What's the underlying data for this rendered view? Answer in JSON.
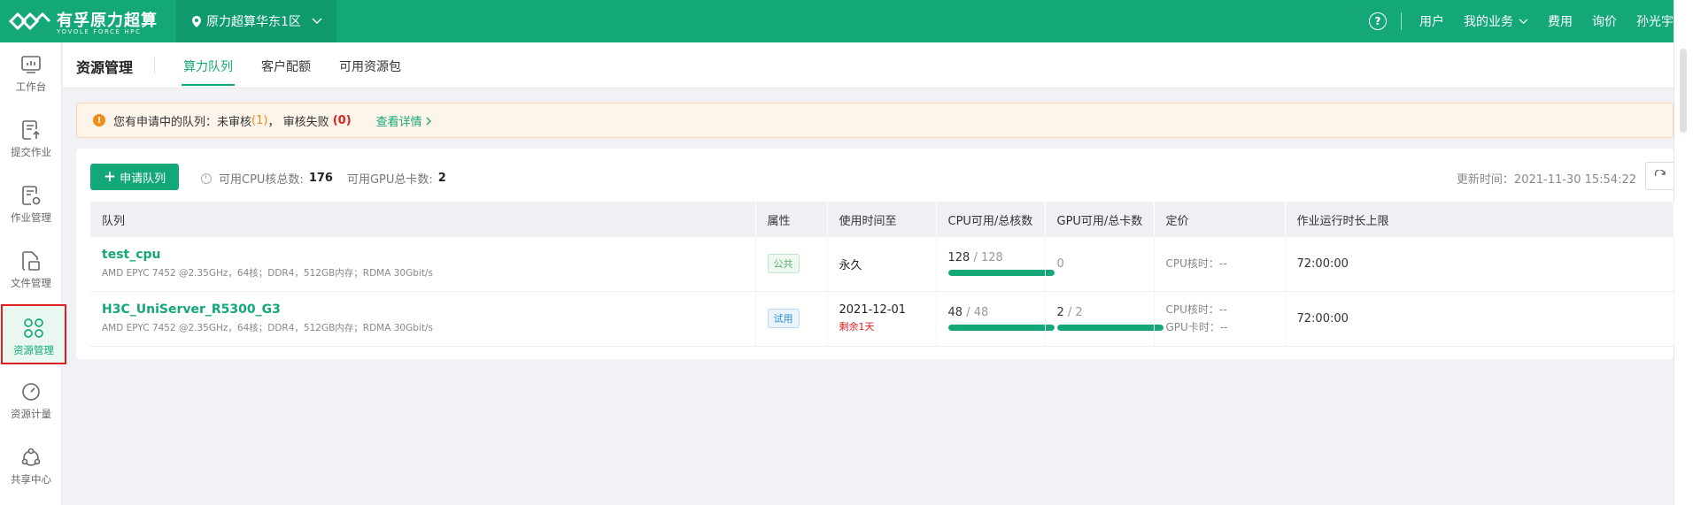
{
  "brand": {
    "name": "有孚原力超算",
    "sub": "YOVOLE FORCE HPC"
  },
  "region": {
    "label": "原力超算华东1区"
  },
  "top_nav": {
    "help": "?",
    "user": "用户",
    "business": "我的业务",
    "fee": "费用",
    "inquiry": "询价",
    "username": "孙光宇"
  },
  "sidebar": {
    "items": [
      {
        "label": "工作台",
        "icon": "dashboard-icon"
      },
      {
        "label": "提交作业",
        "icon": "submit-job-icon"
      },
      {
        "label": "作业管理",
        "icon": "job-manage-icon"
      },
      {
        "label": "文件管理",
        "icon": "file-manage-icon"
      },
      {
        "label": "资源管理",
        "icon": "resource-manage-icon",
        "active": true
      },
      {
        "label": "资源计量",
        "icon": "gauge-icon"
      },
      {
        "label": "共享中心",
        "icon": "share-center-icon"
      }
    ]
  },
  "page": {
    "title": "资源管理",
    "tabs": [
      {
        "label": "算力队列",
        "active": true
      },
      {
        "label": "客户配额"
      },
      {
        "label": "可用资源包"
      }
    ]
  },
  "alert": {
    "prefix": "您有申请中的队列：未审核",
    "pending_count": "(1)",
    "middle": "，  审核失败",
    "failed_count": "(0)",
    "link": "查看详情"
  },
  "toolbar": {
    "apply_label": "申请队列",
    "cpu_label": "可用CPU核总数:",
    "cpu_value": "176",
    "gpu_label": "可用GPU总卡数:",
    "gpu_value": "2",
    "update_label": "更新时间：",
    "update_time": "2021-11-30 15:54:22"
  },
  "table": {
    "headers": [
      "队列",
      "属性",
      "使用时间至",
      "CPU可用/总核数",
      "GPU可用/总卡数",
      "定价",
      "作业运行时长上限"
    ],
    "rows": [
      {
        "name": "test_cpu",
        "desc": "AMD EPYC 7452 @2.35GHz，64核；DDR4，512GB内存；RDMA 30Gbit/s",
        "tag": "公共",
        "expire": "永久",
        "remain": "",
        "cpu_avail": "128",
        "cpu_total": "/ 128",
        "cpu_fraction": 1.0,
        "gpu_text": "0",
        "gpu_total": "",
        "gpu_fraction": null,
        "price_cpu": "CPU核时：--",
        "price_gpu": "",
        "duration": "72:00:00"
      },
      {
        "name": "H3C_UniServer_R5300_G3",
        "desc": "AMD EPYC 7452 @2.35GHz，64核；DDR4，512GB内存；RDMA 30Gbit/s",
        "tag": "试用",
        "expire": "2021-12-01",
        "remain": "剩余1天",
        "cpu_avail": "48",
        "cpu_total": "/ 48",
        "cpu_fraction": 1.0,
        "gpu_text": "2",
        "gpu_total": "/ 2",
        "gpu_fraction": 1.0,
        "price_cpu": "CPU核时：--",
        "price_gpu": "GPU卡时：--",
        "duration": "72:00:00"
      }
    ]
  },
  "colors": {
    "brand": "#14a878",
    "warning": "#f08c1a",
    "danger": "#e02020",
    "info": "#2a8ed6"
  }
}
